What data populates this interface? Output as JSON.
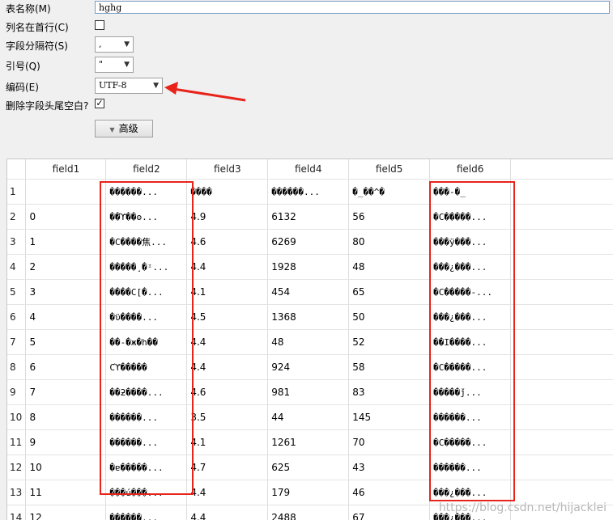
{
  "form": {
    "table_name_label": "表名称(M)",
    "table_name_value": "hghg",
    "first_row_header_label": "列名在首行(C)",
    "first_row_header_checked": false,
    "separator_label": "字段分隔符(S)",
    "separator_value": ",",
    "quote_label": "引号(Q)",
    "quote_value": "\"",
    "encoding_label": "编码(E)",
    "encoding_value": "UTF-8",
    "trim_label": "删除字段头尾空白?",
    "trim_checked": true,
    "advanced_label": "高级"
  },
  "grid": {
    "columns": [
      "",
      "field1",
      "field2",
      "field3",
      "field4",
      "field5",
      "field6"
    ],
    "rows": [
      [
        "1",
        "",
        "������...",
        "����",
        "������...",
        "�_��^�",
        "���-�_"
      ],
      [
        "2",
        "0",
        "��ϓ��ʘ...",
        "4.9",
        "6132",
        "56",
        "�C�����..."
      ],
      [
        "3",
        "1",
        "�C����焦...",
        "4.6",
        "6269",
        "80",
        "���ÿ���..."
      ],
      [
        "4",
        "2",
        "�����¸�ᶦ...",
        "4.4",
        "1928",
        "48",
        "���¿���..."
      ],
      [
        "5",
        "3",
        "����C[�...",
        "4.1",
        "454",
        "65",
        "�C�����-..."
      ],
      [
        "6",
        "4",
        "�ϋ����...",
        "4.5",
        "1368",
        "50",
        "���¿���..."
      ],
      [
        "7",
        "5",
        "��-�ж�h��",
        "4.4",
        "48",
        "52",
        "��Ι����..."
      ],
      [
        "8",
        "6",
        "Cϓ�����",
        "4.4",
        "924",
        "58",
        "�C�����..."
      ],
      [
        "9",
        "7",
        "��ƻ����...",
        "4.6",
        "981",
        "83",
        "�����ǰ..."
      ],
      [
        "10",
        "8",
        "������...",
        "3.5",
        "44",
        "145",
        "������..."
      ],
      [
        "11",
        "9",
        "������...",
        "4.1",
        "1261",
        "70",
        "�C�����..."
      ],
      [
        "12",
        "10",
        "�ɐ�����...",
        "4.7",
        "625",
        "43",
        "������..."
      ],
      [
        "13",
        "11",
        "���ú���...",
        "4.4",
        "179",
        "46",
        "���¿���..."
      ],
      [
        "14",
        "12",
        "������...",
        "4.4",
        "2488",
        "67",
        "���¿���..."
      ]
    ]
  },
  "watermark": "https://blog.csdn.net/hijacklei",
  "colors": {
    "highlight": "#e8231a",
    "arrow": "#e8231a"
  }
}
